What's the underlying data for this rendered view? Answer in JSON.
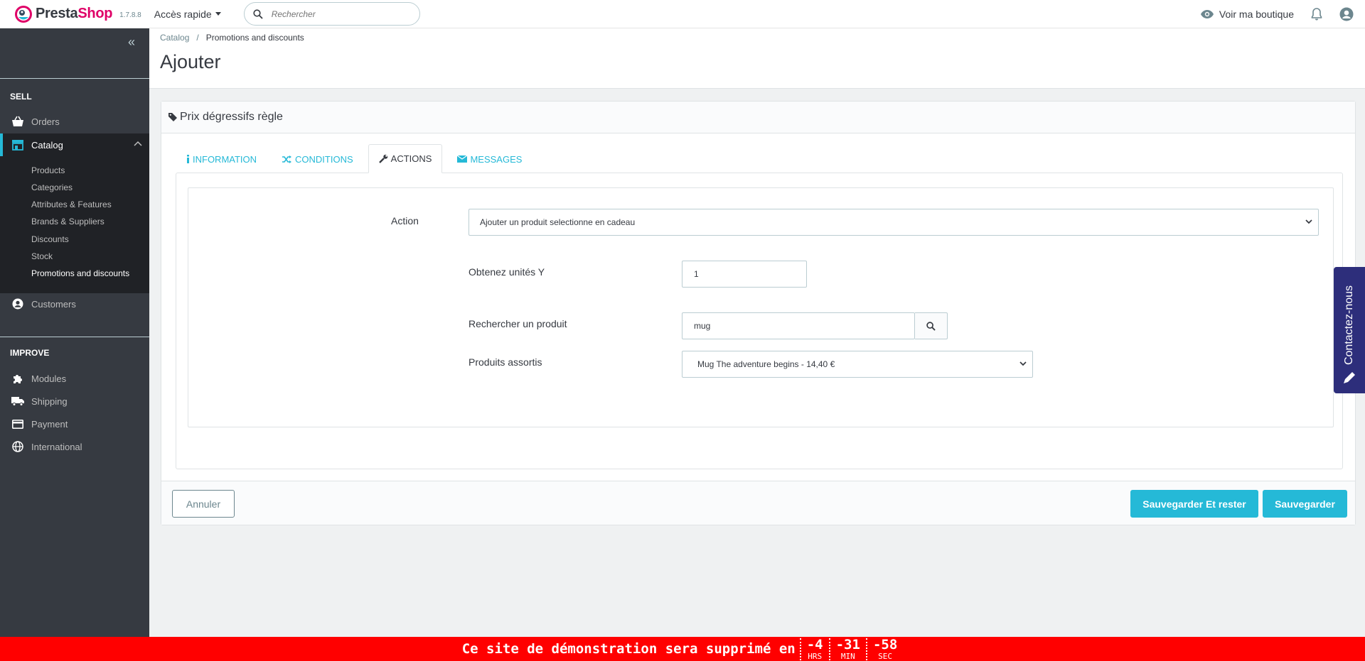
{
  "header": {
    "logo_text_a": "Presta",
    "logo_text_b": "Shop",
    "version": "1.7.8.8",
    "quick_access": "Accès rapide",
    "search_placeholder": "Rechercher",
    "view_shop": "Voir ma boutique"
  },
  "sidebar": {
    "sell_title": "SELL",
    "orders": "Orders",
    "catalog": "Catalog",
    "catalog_sub": [
      "Products",
      "Categories",
      "Attributes & Features",
      "Brands & Suppliers",
      "Discounts",
      "Stock",
      "Promotions and discounts"
    ],
    "customers": "Customers",
    "improve_title": "IMPROVE",
    "modules": "Modules",
    "shipping": "Shipping",
    "payment": "Payment",
    "international": "International"
  },
  "breadcrumb": {
    "parent": "Catalog",
    "current": "Promotions and discounts"
  },
  "page_title": "Ajouter",
  "panel": {
    "heading": "Prix dégressifs règle",
    "tabs": [
      "INFORMATION",
      "CONDITIONS",
      "ACTIONS",
      "MESSAGES"
    ],
    "active_tab": "ACTIONS",
    "form": {
      "action_label": "Action",
      "action_value": "Ajouter un produit selectionne en cadeau",
      "units_label": "Obtenez unités Y",
      "units_value": "1",
      "search_label": "Rechercher un produit",
      "search_value": "mug",
      "matched_label": "Produits assortis",
      "matched_value": "Mug The adventure begins - 14,40 €"
    },
    "cancel": "Annuler",
    "save_stay": "Sauvegarder Et rester",
    "save": "Sauvegarder"
  },
  "contact": "Contactez-nous",
  "banner": {
    "message": "Ce site de démonstration sera supprimé en",
    "hours": "-4",
    "hours_unit": "HRS",
    "minutes": "-31",
    "minutes_unit": "MIN",
    "seconds": "-58",
    "seconds_unit": "SEC"
  },
  "colors": {
    "accent": "#25b9d7",
    "brand_pink": "#df0067",
    "sidebar": "#363a41",
    "banner": "#ff0000",
    "contact": "#2d2e7b"
  }
}
